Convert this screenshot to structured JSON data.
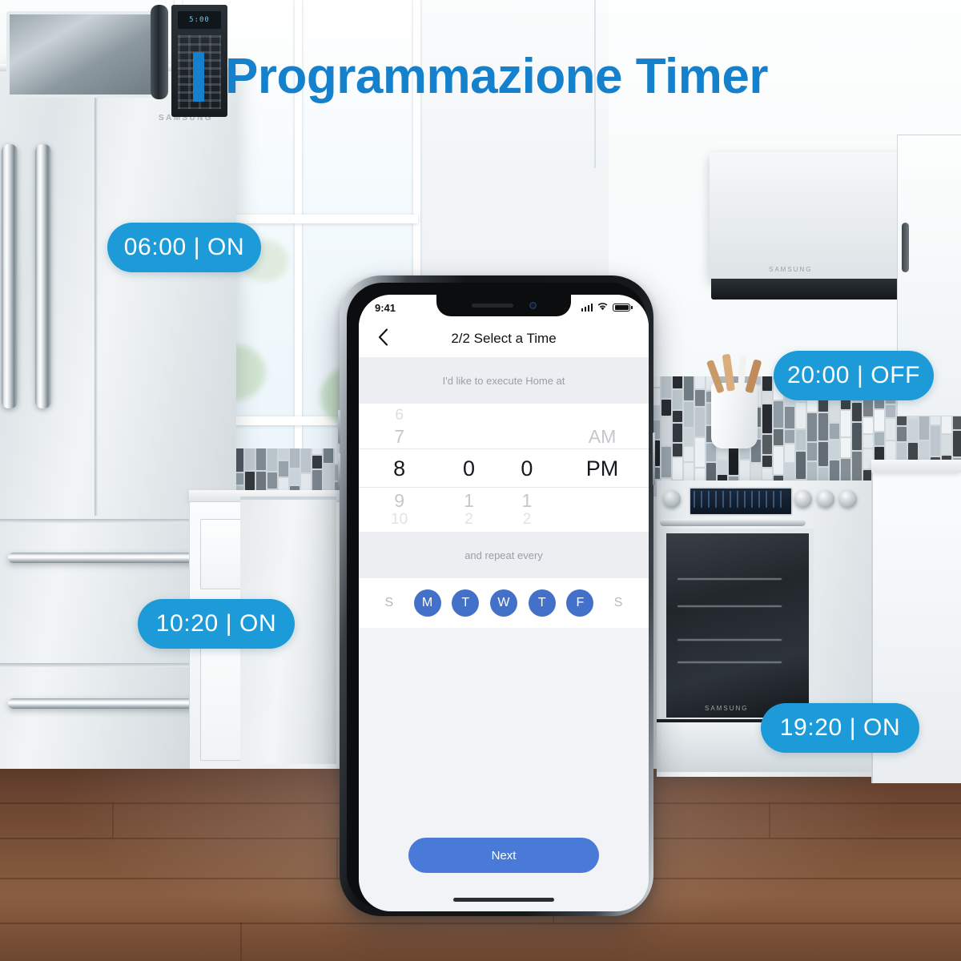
{
  "header": {
    "title": "Programmazione Timer",
    "accent_color": "#1580cc"
  },
  "badges": [
    {
      "label": "06:00 | ON",
      "time": "06:00",
      "state": "ON",
      "color": "#1d9ad8"
    },
    {
      "label": "20:00 | OFF",
      "time": "20:00",
      "state": "OFF",
      "color": "#1d9ad8"
    },
    {
      "label": "10:20 | ON",
      "time": "10:20",
      "state": "ON",
      "color": "#1d9ad8"
    },
    {
      "label": "19:20 | ON",
      "time": "19:20",
      "state": "ON",
      "color": "#1d9ad8"
    }
  ],
  "phone": {
    "status_bar": {
      "time": "9:41",
      "signal_icon": "cellular-signal-icon",
      "wifi_icon": "wifi-icon",
      "battery_icon": "battery-full-icon"
    },
    "nav": {
      "back_icon": "chevron-left-icon",
      "title": "2/2 Select a Time"
    },
    "execute_label": "I'd like to execute Home at",
    "time_picker": {
      "hours": {
        "faint_above_2": "6",
        "faint_above": "7",
        "selected": "8",
        "faint_below": "9",
        "faint_below_2": "10"
      },
      "minute_tens": {
        "faint_above_2": "",
        "faint_above": "",
        "selected": "0",
        "faint_below": "1",
        "faint_below_2": "2"
      },
      "minute_ones": {
        "faint_above_2": "",
        "faint_above": "",
        "selected": "0",
        "faint_below": "1",
        "faint_below_2": "2"
      },
      "meridiem": {
        "faint_above_2": "",
        "faint_above": "AM",
        "selected": "PM",
        "faint_below": "",
        "faint_below_2": ""
      },
      "selected_value": "8:00 PM"
    },
    "repeat_label": "and repeat every",
    "days": [
      {
        "letter": "S",
        "name": "Sunday",
        "selected": false
      },
      {
        "letter": "M",
        "name": "Monday",
        "selected": true
      },
      {
        "letter": "T",
        "name": "Tuesday",
        "selected": true
      },
      {
        "letter": "W",
        "name": "Wednesday",
        "selected": true
      },
      {
        "letter": "T",
        "name": "Thursday",
        "selected": true
      },
      {
        "letter": "F",
        "name": "Friday",
        "selected": true
      },
      {
        "letter": "S",
        "name": "Saturday",
        "selected": false
      }
    ],
    "next_button": "Next",
    "day_selected_color": "#4371c9",
    "next_button_color": "#4a7ad8"
  },
  "appliances": {
    "fridge_brand": "SAMSUNG",
    "microwave_brand": "SAMSUNG",
    "microwave_display": "5:00",
    "range_brand": "SAMSUNG"
  }
}
